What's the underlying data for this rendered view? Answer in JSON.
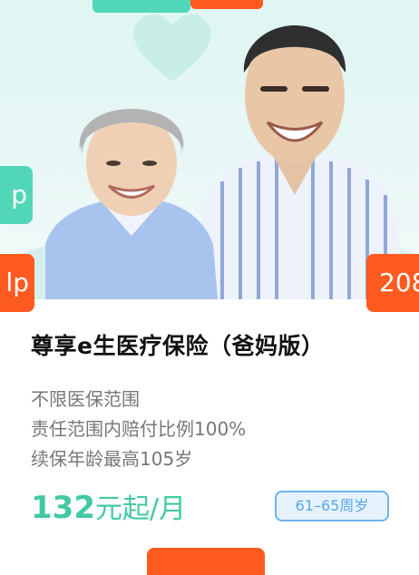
{
  "colors": {
    "accent_green": "#52d6b8",
    "accent_orange": "#ff5a1f",
    "price_green": "#43c9a2",
    "age_blue": "#5aa6e8"
  },
  "side_badges": {
    "left_green_text": "p",
    "left_orange_text": "lp",
    "right_orange_text": "208"
  },
  "product": {
    "title": "尊享e生医疗保险（爸妈版）",
    "features": [
      "不限医保范围",
      "责任范围内赔付比例100%",
      "续保年龄最高105岁"
    ],
    "price_number": "132",
    "price_unit": "元起/月",
    "age_range": "61–65周岁"
  },
  "icons": [
    "heart-icon"
  ]
}
